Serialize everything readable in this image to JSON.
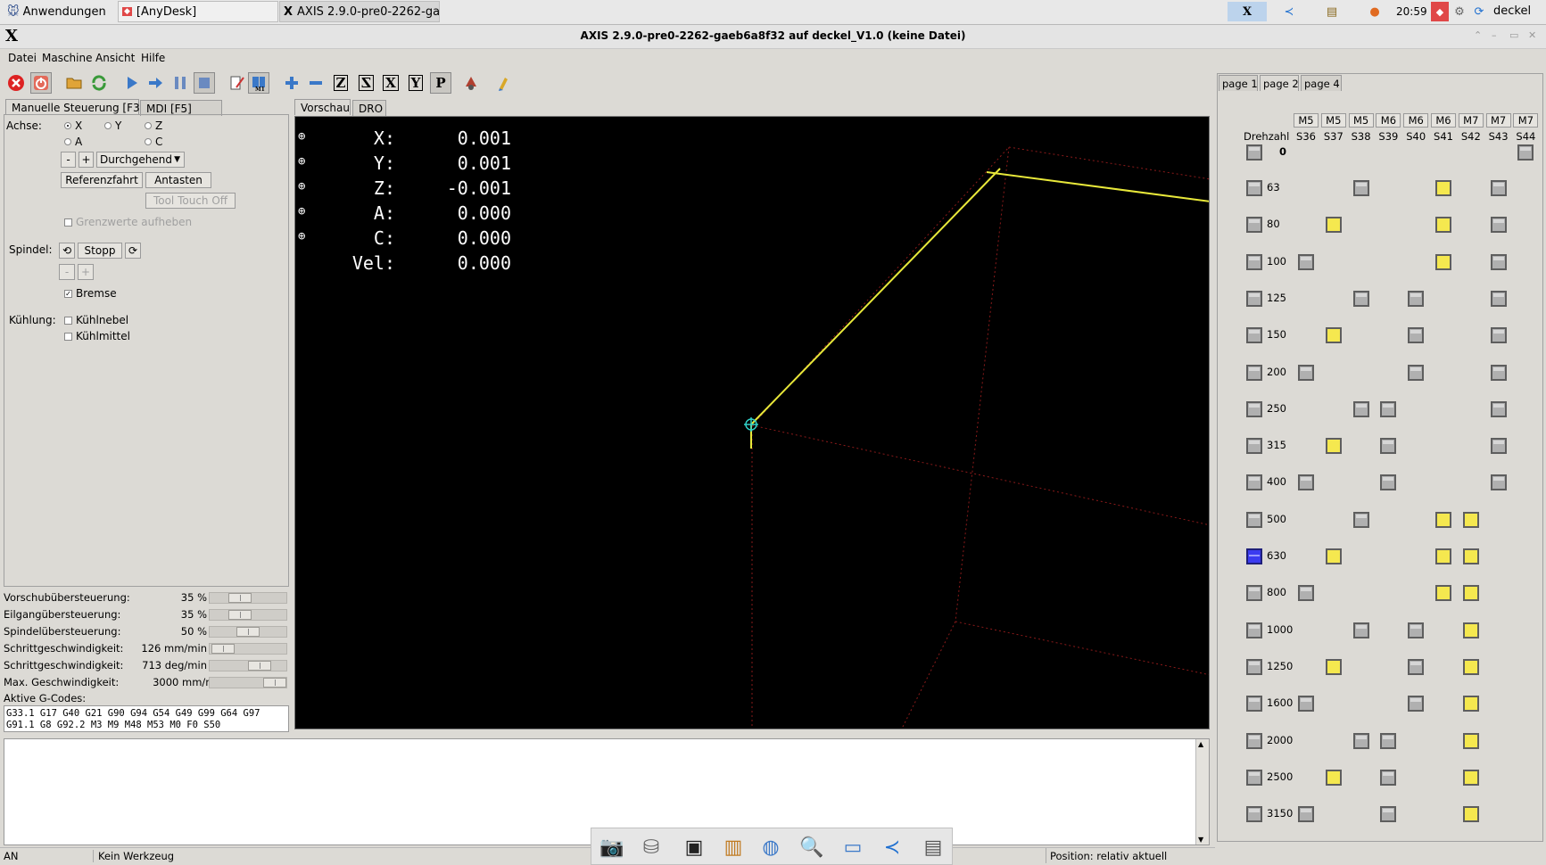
{
  "taskbar": {
    "apps_menu": "Anwendungen",
    "tasks": [
      "[AnyDesk]",
      "AXIS 2.9.0-pre0-2262-ga..."
    ],
    "clock": "20:59",
    "user": "deckel"
  },
  "window": {
    "title": "AXIS 2.9.0-pre0-2262-gaeb6a8f32 auf  deckel_V1.0 (keine Datei)",
    "logo": "X"
  },
  "menu": {
    "items": [
      "Datei",
      "Maschine",
      "Ansicht",
      "Hilfe"
    ]
  },
  "toolbar": {
    "icons": [
      "estop-icon",
      "power-icon",
      "open-file-icon",
      "reload-icon",
      "run-icon",
      "step-icon",
      "pause-icon",
      "stop-icon",
      "edit-icon",
      "block-delete-icon",
      "zoom-in-icon",
      "zoom-out-icon",
      "view-z-icon",
      "view-z2-icon",
      "view-x-icon",
      "view-y-icon",
      "view-p-icon",
      "rotate-icon",
      "clear-plot-icon"
    ],
    "view_labels": [
      "Z",
      "Z",
      "X",
      "Y",
      "P"
    ]
  },
  "left_tabs": [
    "Manuelle Steuerung [F3]",
    "MDI [F5]"
  ],
  "manual": {
    "axis_label": "Achse:",
    "axes": [
      "X",
      "Y",
      "Z",
      "A",
      "C"
    ],
    "selected_axis": "X",
    "minus": "-",
    "plus": "+",
    "jog_mode": "Durchgehend",
    "home_button": "Referenzfahrt",
    "touch_button": "Antasten",
    "tool_touch_off": "Tool Touch Off",
    "override_limits": "Grenzwerte aufheben",
    "spindle_label": "Spindel:",
    "spindle_stop": "Stopp",
    "brake": "Bremse",
    "brake_checked": true,
    "coolant_label": "Kühlung:",
    "mist": "Kühlnebel",
    "flood": "Kühlmittel"
  },
  "overrides": [
    {
      "label": "Vorschubübersteuerung:",
      "value": "35 %",
      "fraction": 0.35
    },
    {
      "label": "Eilgangübersteuerung:",
      "value": "35 %",
      "fraction": 0.35
    },
    {
      "label": "Spindelübersteuerung:",
      "value": "50 %",
      "fraction": 0.5
    },
    {
      "label": "Schrittgeschwindigkeit:",
      "value": "126 mm/min",
      "fraction": 0.04
    },
    {
      "label": "Schrittgeschwindigkeit:",
      "value": "713 deg/min",
      "fraction": 0.71
    },
    {
      "label": "Max. Geschwindigkeit:",
      "value": "3000 mm/min",
      "fraction": 1.0
    }
  ],
  "gcodes": {
    "label": "Aktive G-Codes:",
    "line1": "G33.1 G17 G40 G21 G90 G94 G54 G49 G99 G64 G97",
    "line2": "G91.1 G8 G92.2 M3 M9 M48 M53 M0 F0 S50"
  },
  "preview_tabs": [
    "Vorschau",
    "DRO"
  ],
  "dro": [
    {
      "axis": "X:",
      "value": "0.001"
    },
    {
      "axis": "Y:",
      "value": "0.001"
    },
    {
      "axis": "Z:",
      "value": "-0.001"
    },
    {
      "axis": "A:",
      "value": "0.000"
    },
    {
      "axis": "C:",
      "value": "0.000"
    },
    {
      "axis": "Vel:",
      "value": "0.000"
    }
  ],
  "status": {
    "state": "AN",
    "tool": "Kein Werkzeug",
    "position": "Position: relativ aktuell"
  },
  "right_panel": {
    "tabs": [
      "page 1",
      "page 2",
      "page 4"
    ],
    "active_tab": "page 2",
    "drehzahl": "Drehzahl",
    "col_top": [
      "M5",
      "M5",
      "M5",
      "M6",
      "M6",
      "M6",
      "M7",
      "M7",
      "M7"
    ],
    "col_bottom": [
      "S36",
      "S37",
      "S38",
      "S39",
      "S40",
      "S41",
      "S42",
      "S43",
      "S44"
    ],
    "speeds": [
      "0",
      "63",
      "80",
      "100",
      "125",
      "150",
      "200",
      "250",
      "315",
      "400",
      "500",
      "630",
      "800",
      "1000",
      "1250",
      "1600",
      "2000",
      "2500",
      "3150"
    ],
    "active_speed": "630",
    "cells": [
      [
        [
          8,
          "gray"
        ]
      ],
      [
        [
          2,
          "gray"
        ],
        [
          5,
          "yellow"
        ],
        [
          7,
          "gray"
        ]
      ],
      [
        [
          1,
          "yellow"
        ],
        [
          5,
          "yellow"
        ],
        [
          7,
          "gray"
        ]
      ],
      [
        [
          0,
          "gray"
        ],
        [
          5,
          "yellow"
        ],
        [
          7,
          "gray"
        ]
      ],
      [
        [
          2,
          "gray"
        ],
        [
          4,
          "gray"
        ],
        [
          7,
          "gray"
        ]
      ],
      [
        [
          1,
          "yellow"
        ],
        [
          4,
          "gray"
        ],
        [
          7,
          "gray"
        ]
      ],
      [
        [
          0,
          "gray"
        ],
        [
          4,
          "gray"
        ],
        [
          7,
          "gray"
        ]
      ],
      [
        [
          2,
          "gray"
        ],
        [
          3,
          "gray"
        ],
        [
          7,
          "gray"
        ]
      ],
      [
        [
          1,
          "yellow"
        ],
        [
          3,
          "gray"
        ],
        [
          7,
          "gray"
        ]
      ],
      [
        [
          0,
          "gray"
        ],
        [
          3,
          "gray"
        ],
        [
          7,
          "gray"
        ]
      ],
      [
        [
          2,
          "gray"
        ],
        [
          5,
          "yellow"
        ],
        [
          6,
          "yellow"
        ]
      ],
      [
        [
          1,
          "yellow"
        ],
        [
          5,
          "yellow"
        ],
        [
          6,
          "yellow"
        ]
      ],
      [
        [
          0,
          "gray"
        ],
        [
          5,
          "yellow"
        ],
        [
          6,
          "yellow"
        ]
      ],
      [
        [
          2,
          "gray"
        ],
        [
          4,
          "gray"
        ],
        [
          6,
          "yellow"
        ]
      ],
      [
        [
          1,
          "yellow"
        ],
        [
          4,
          "gray"
        ],
        [
          6,
          "yellow"
        ]
      ],
      [
        [
          0,
          "gray"
        ],
        [
          4,
          "gray"
        ],
        [
          6,
          "yellow"
        ]
      ],
      [
        [
          2,
          "gray"
        ],
        [
          3,
          "gray"
        ],
        [
          6,
          "yellow"
        ]
      ],
      [
        [
          1,
          "yellow"
        ],
        [
          3,
          "gray"
        ],
        [
          6,
          "yellow"
        ]
      ],
      [
        [
          0,
          "gray"
        ],
        [
          3,
          "gray"
        ],
        [
          6,
          "yellow"
        ]
      ]
    ]
  },
  "dock": [
    "screenshot-icon",
    "drive-icon",
    "terminal-icon",
    "archive-icon",
    "browser-icon",
    "search-icon",
    "folder-icon",
    "vscode-icon",
    "notes-icon"
  ]
}
